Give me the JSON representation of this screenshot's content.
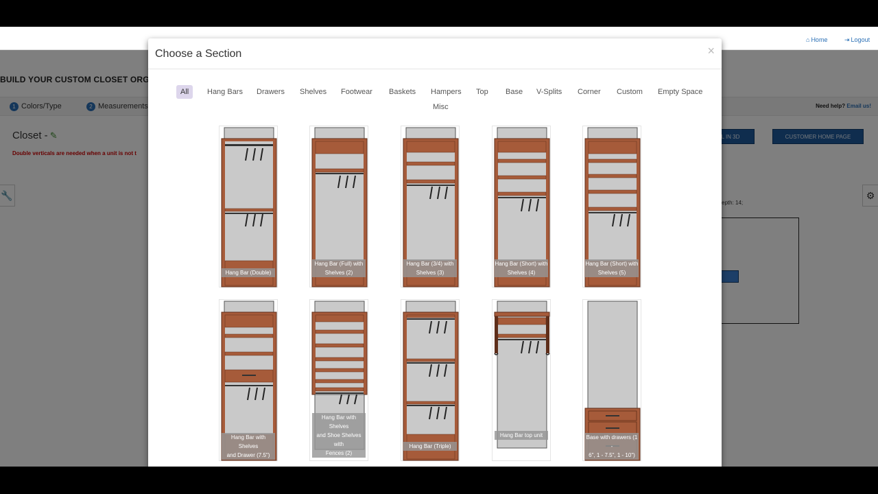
{
  "topbar": {
    "home": "Home",
    "logout": "Logout"
  },
  "page": {
    "heading": "BUILD YOUR CUSTOM CLOSET ORGAN",
    "steps": [
      {
        "num": "1",
        "label": "Colors/Type"
      },
      {
        "num": "2",
        "label": "Measurements"
      }
    ],
    "help_prefix": "Need help?",
    "help_link": "Email us!",
    "closet_title": "Closet -",
    "warning": "Double verticals are needed when a unit is not t",
    "view_3d_button": "L IN 3D",
    "customer_home_button": "CUSTOMER HOME PAGE",
    "depth_text": "epth: 14;"
  },
  "modal": {
    "title": "Choose a Section",
    "close": "×",
    "tabs": [
      "All",
      "Hang Bars",
      "Drawers",
      "Shelves",
      "Footwear",
      "Baskets",
      "Hampers",
      "Top",
      "Base",
      "V-Splits",
      "Corner",
      "Custom",
      "Empty Space",
      "Misc"
    ],
    "active_tab": "All",
    "sections": [
      {
        "label_lines": [
          "Hang Bar (Double)"
        ]
      },
      {
        "label_lines": [
          "Hang Bar (Full) with",
          "Shelves (2)"
        ]
      },
      {
        "label_lines": [
          "Hang Bar (3/4) with",
          "Shelves (3)"
        ]
      },
      {
        "label_lines": [
          "Hang Bar (Short) with",
          "Shelves (4)"
        ]
      },
      {
        "label_lines": [
          "Hang Bar (Short) with",
          "Shelves (5)"
        ]
      },
      {
        "label_lines": [
          "Hang Bar with Shelves",
          "and Drawer (7.5\")"
        ]
      },
      {
        "label_lines": [
          "Hang Bar with Shelves",
          "and Shoe Shelves with",
          "Fences (2)"
        ]
      },
      {
        "label_lines": [
          "Hang Bar (Triple)"
        ]
      },
      {
        "label_lines": [
          "Hang Bar top unit"
        ]
      },
      {
        "label_lines": [
          "Base with drawers (1 -",
          "6\", 1 - 7.5\", 1 - 10\")"
        ]
      }
    ]
  },
  "colors": {
    "wood": "#a65b3a",
    "wood_dark": "#5e2e1a",
    "panel": "#c9c9c9",
    "accent": "#2a6fb5",
    "active_tab_bg": "#ddd6ec"
  },
  "icons": {
    "home": "home-icon",
    "logout": "logout-icon",
    "close": "close-icon",
    "pencil": "pencil-icon",
    "wrench": "wrench-icon",
    "gear": "gear-icon",
    "hanger": "hanger-icon"
  }
}
